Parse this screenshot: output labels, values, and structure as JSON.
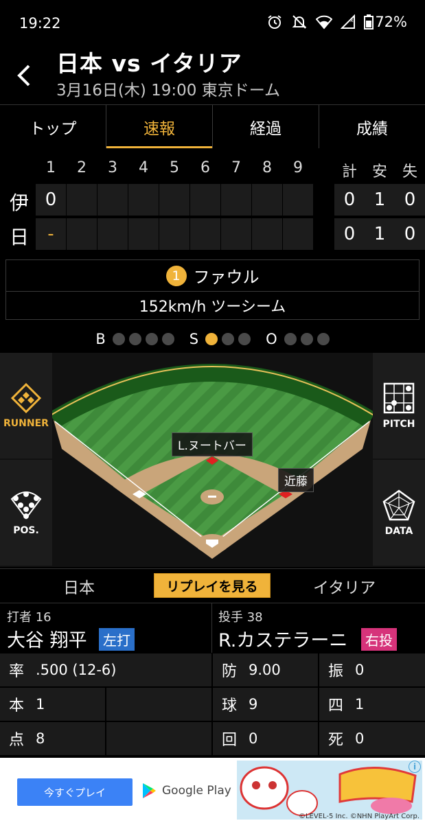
{
  "status_bar": {
    "time": "19:22",
    "battery": "72%"
  },
  "header": {
    "title": "日本 vs イタリア",
    "subtitle": "3月16日(木) 19:00 東京ドーム"
  },
  "tabs": [
    {
      "label": "トップ",
      "active": false
    },
    {
      "label": "速報",
      "active": true
    },
    {
      "label": "経過",
      "active": false
    },
    {
      "label": "成績",
      "active": false
    }
  ],
  "scoreboard": {
    "innings": [
      "1",
      "2",
      "3",
      "4",
      "5",
      "6",
      "7",
      "8",
      "9"
    ],
    "totals_headers": [
      "計",
      "安",
      "失"
    ],
    "teams": [
      {
        "label": "伊",
        "innings": [
          "0",
          "",
          "",
          "",
          "",
          "",
          "",
          "",
          ""
        ],
        "totals": [
          "0",
          "1",
          "0"
        ]
      },
      {
        "label": "日",
        "innings": [
          "-",
          "",
          "",
          "",
          "",
          "",
          "",
          "",
          ""
        ],
        "totals": [
          "0",
          "1",
          "0"
        ]
      }
    ]
  },
  "pitch": {
    "number": "1",
    "result": "ファウル",
    "detail": "152km/h ツーシーム"
  },
  "count": {
    "b_label": "B",
    "s_label": "S",
    "o_label": "O",
    "balls": 0,
    "strikes": 1,
    "outs": 0
  },
  "field": {
    "runner_label": "RUNNER",
    "pos_label": "POS.",
    "pitch_label": "PITCH",
    "data_label": "DATA",
    "runner_first": "近藤",
    "runner_second": "L.ヌートバー"
  },
  "replay": {
    "home_team": "日本",
    "button": "リプレイを見る",
    "away_team": "イタリア"
  },
  "batter": {
    "role": "打者 16",
    "name": "大谷 翔平",
    "tag": "左打",
    "tag_color": "#2a6fc9"
  },
  "pitcher": {
    "role": "投手 38",
    "name": "R.カステラーニ",
    "tag": "右投",
    "tag_color": "#d6337a"
  },
  "batter_stats": [
    {
      "key": "率",
      "value": ".500 (12-6)"
    },
    {
      "key": "本",
      "value": "1"
    },
    {
      "key": "点",
      "value": "8"
    }
  ],
  "pitcher_stats": [
    {
      "key": "防",
      "value": "9.00"
    },
    {
      "key": "振",
      "value": "0"
    },
    {
      "key": "球",
      "value": "9"
    },
    {
      "key": "四",
      "value": "1"
    },
    {
      "key": "回",
      "value": "0"
    },
    {
      "key": "死",
      "value": "0"
    }
  ],
  "ad": {
    "button": "今すぐプレイ",
    "store": "Google Play",
    "copyright": "©LEVEL-5 Inc. ©NHN PlayArt Corp."
  },
  "colors": {
    "accent": "#f0b33a",
    "grass": "#3f8a3a",
    "dirt": "#c9a57a"
  }
}
